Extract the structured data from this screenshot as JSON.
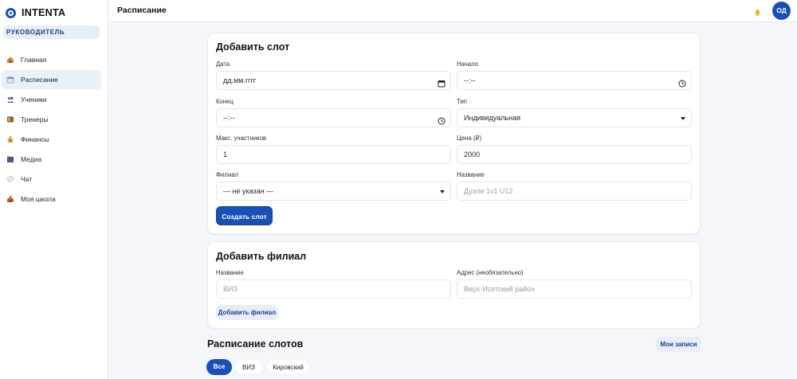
{
  "brand": {
    "name": "INTENTA",
    "role": "РУКОВОДИТЕЛЬ"
  },
  "sidebar": {
    "items": [
      {
        "label": "Главная",
        "icon": "home-icon",
        "color": "#c98a3a"
      },
      {
        "label": "Расписание",
        "icon": "calendar-icon",
        "color": "#7b8fc8",
        "active": true
      },
      {
        "label": "Ученики",
        "icon": "students-icon",
        "color": "#6a6f9e"
      },
      {
        "label": "Тренеры",
        "icon": "coaches-icon",
        "color": "#8b5a2b"
      },
      {
        "label": "Финансы",
        "icon": "money-bag-icon",
        "color": "#d7a03a"
      },
      {
        "label": "Медиа",
        "icon": "film-icon",
        "color": "#5b4e8a"
      },
      {
        "label": "Чат",
        "icon": "chat-bubble-icon",
        "color": "#b9c2d6"
      },
      {
        "label": "Моя школа",
        "icon": "school-icon",
        "color": "#b5653d"
      }
    ]
  },
  "header": {
    "title": "Расписание",
    "avatar_initials": "ОД",
    "notification_icon": "bell-icon"
  },
  "add_slot": {
    "title": "Добавить слот",
    "date_label": "Дата",
    "date_value": "дд.мм.гггг",
    "start_label": "Начало",
    "start_value": "--:--",
    "end_label": "Конец",
    "end_value": "--:--",
    "type_label": "Тип",
    "type_value": "Индивидуальная",
    "max_label": "Макс. участников",
    "max_value": "1",
    "price_label": "Цена (₽)",
    "price_value": "2000",
    "branch_label": "Филиал",
    "branch_value": "— не указан —",
    "name_label": "Название",
    "name_placeholder": "Дуэли 1v1 U12",
    "submit_label": "Создать слот"
  },
  "add_branch": {
    "title": "Добавить филиал",
    "name_label": "Название",
    "name_placeholder": "ВИЗ",
    "address_label": "Адрес (необязательно)",
    "address_placeholder": "Верх-Исетский район",
    "submit_label": "Добавить филиал"
  },
  "schedule": {
    "title": "Расписание слотов",
    "my_bookings_label": "Мои записи",
    "filters": [
      "Все",
      "ВИЗ",
      "Кировский"
    ]
  },
  "colors": {
    "accent": "#1a4fb5",
    "accent_light": "#e9eef6",
    "page_bg": "#f4f6f9"
  }
}
